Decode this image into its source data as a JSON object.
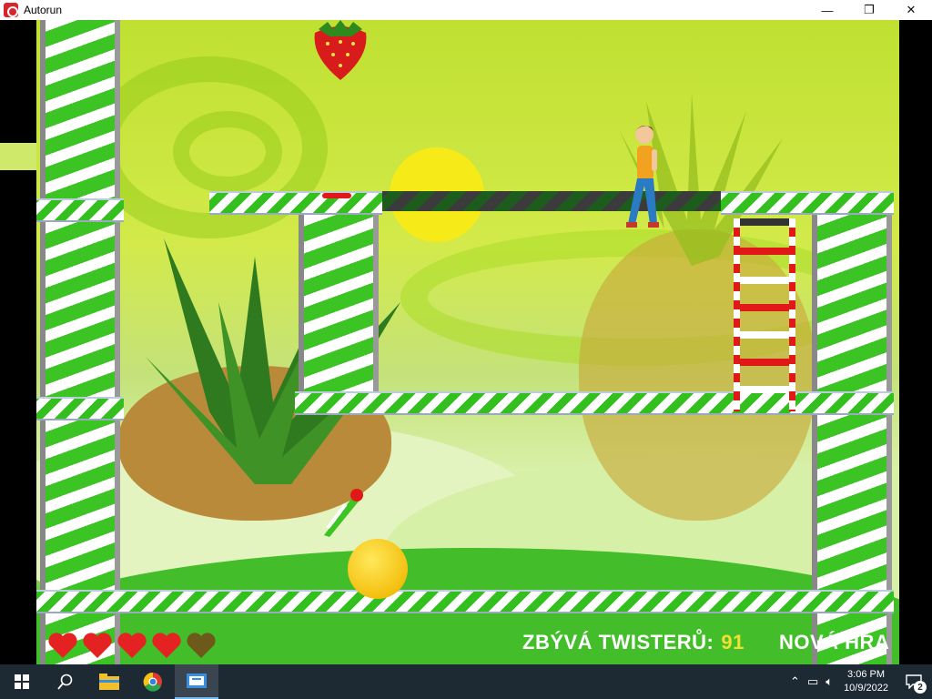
{
  "window": {
    "title": "Autorun",
    "minimize": "—",
    "maximize": "❐",
    "close": "✕"
  },
  "hud": {
    "lives_total": 5,
    "lives_full": 4,
    "twisters_label": "ZBÝVÁ TWISTERŮ:",
    "twisters_count": "91",
    "new_game": "NOVÁ HRA"
  },
  "taskbar": {
    "time": "3:06 PM",
    "date": "10/9/2022",
    "notification_count": "2",
    "icons": [
      "windows-start-icon",
      "search-icon",
      "file-explorer-icon",
      "chrome-icon",
      "autorun-app-icon"
    ]
  },
  "colors": {
    "accent": "#33c01e",
    "twisters_count": "#f0e030"
  }
}
